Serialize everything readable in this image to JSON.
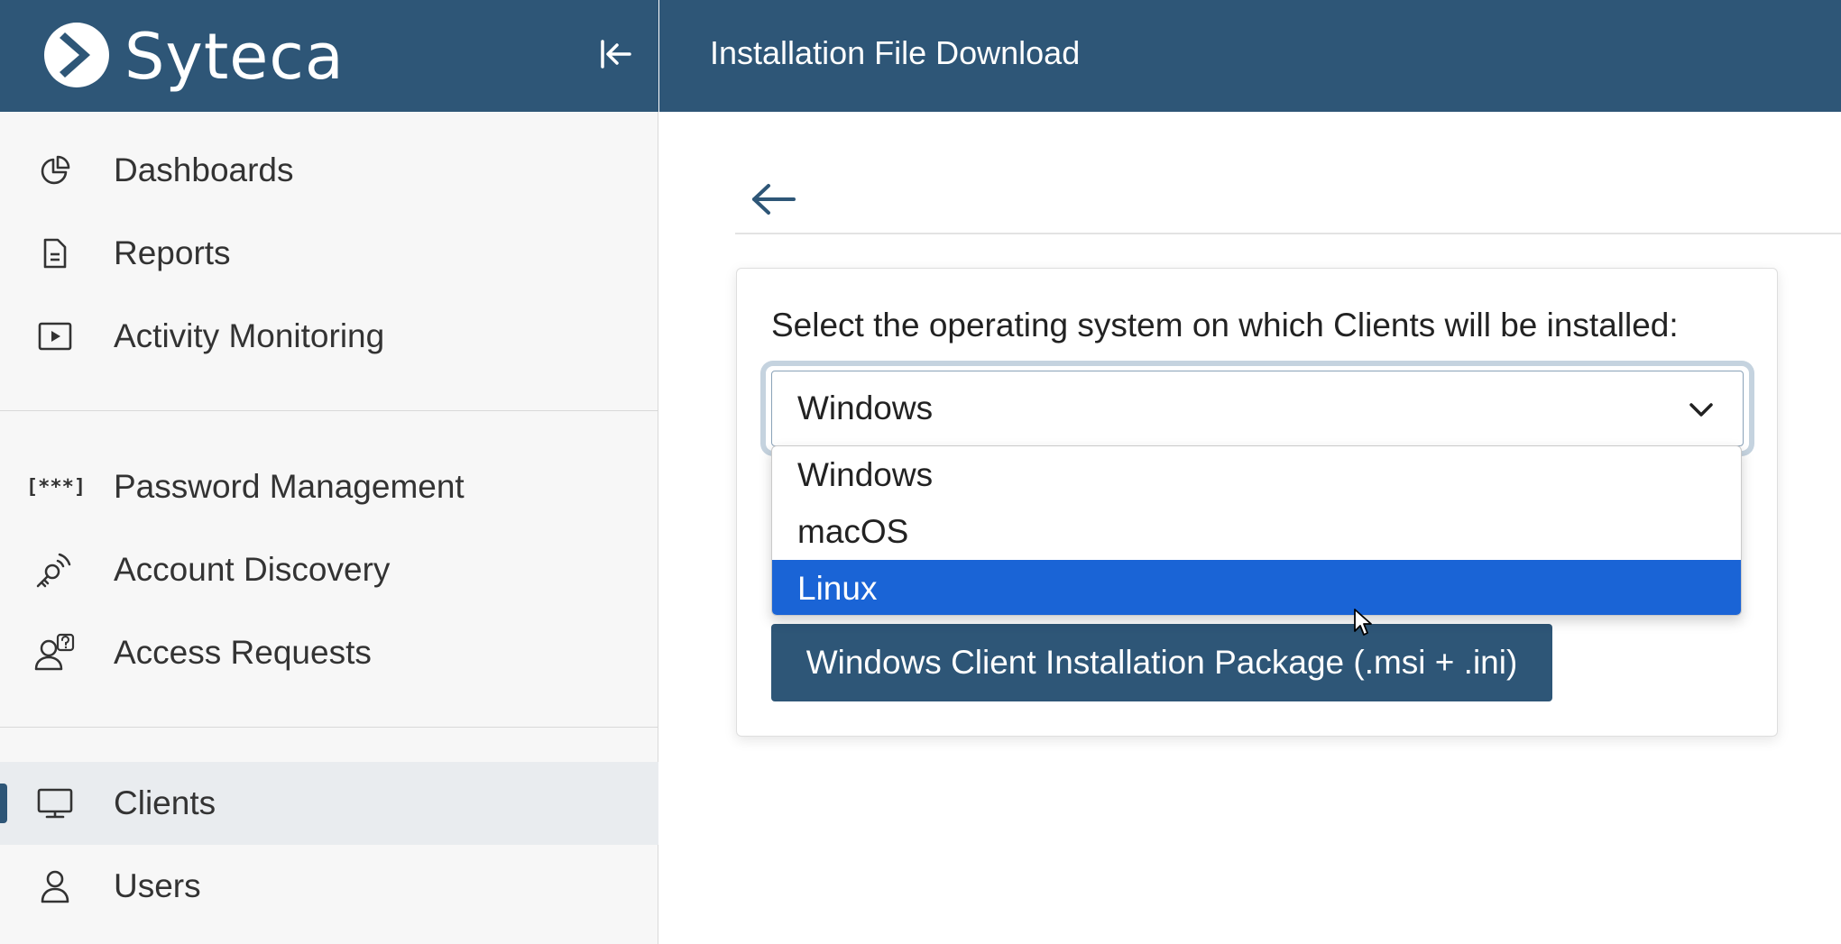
{
  "app": {
    "name": "Syteca"
  },
  "header": {
    "title": "Installation File Download"
  },
  "sidebar": {
    "groups": [
      {
        "items": [
          {
            "label": "Dashboards",
            "icon": "pie-chart-icon"
          },
          {
            "label": "Reports",
            "icon": "document-icon"
          },
          {
            "label": "Activity Monitoring",
            "icon": "play-video-icon"
          }
        ]
      },
      {
        "items": [
          {
            "label": "Password Management",
            "icon": "password-asterisk-icon",
            "icon_text": "[***]"
          },
          {
            "label": "Account Discovery",
            "icon": "key-signal-icon"
          },
          {
            "label": "Access Requests",
            "icon": "user-question-icon"
          }
        ]
      },
      {
        "items": [
          {
            "label": "Clients",
            "icon": "monitor-icon",
            "active": true
          },
          {
            "label": "Users",
            "icon": "user-icon"
          }
        ]
      }
    ]
  },
  "main": {
    "os_prompt": "Select the operating system on which Clients will be installed:",
    "os_select": {
      "value": "Windows",
      "options": [
        "Windows",
        "macOS",
        "Linux"
      ],
      "highlighted": "Linux"
    },
    "download_button": "Windows Client Installation Package (.msi + .ini)"
  },
  "colors": {
    "brand": "#2e5677",
    "highlight": "#1a64d6",
    "sidebar_bg": "#f7f7f7"
  }
}
